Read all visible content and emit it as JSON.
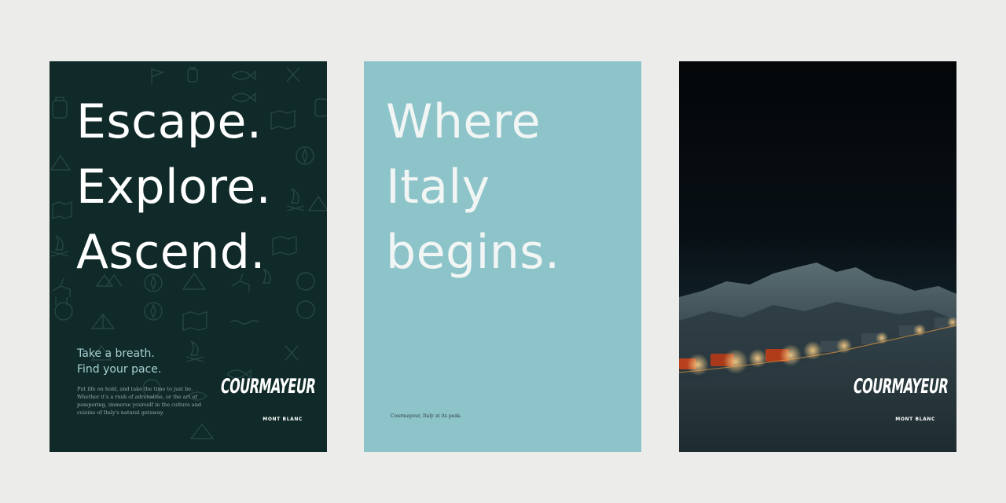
{
  "posters": [
    {
      "headline": [
        "Escape.",
        "Explore.",
        "Ascend."
      ],
      "subhead": [
        "Take a breath.",
        "Find your pace."
      ],
      "body": "Put life on hold, and take the time to just be. Whether it's a rush of adrenaline, or the art of pampering, immerse yourself in the culture and cuisine of Italy's natural getaway.",
      "logo": "COURMAYEUR",
      "logo_sub": "MONT BLANC"
    },
    {
      "headline": [
        "Where",
        "Italy",
        "begins."
      ],
      "tagline": "Courmayeur, Italy at its peak."
    },
    {
      "logo": "COURMAYEUR",
      "logo_sub": "MONT BLANC"
    }
  ],
  "colors": {
    "dark_green": "#0f2a28",
    "aqua": "#8dc4ca",
    "night": "#081015",
    "headlight": "#f2a040"
  },
  "icons": [
    "flag-icon",
    "lantern-icon",
    "backpack-icon",
    "fish-icon",
    "compass-icon",
    "mountain-icon",
    "map-icon",
    "campfire-icon",
    "deer-icon",
    "tent-icon"
  ]
}
